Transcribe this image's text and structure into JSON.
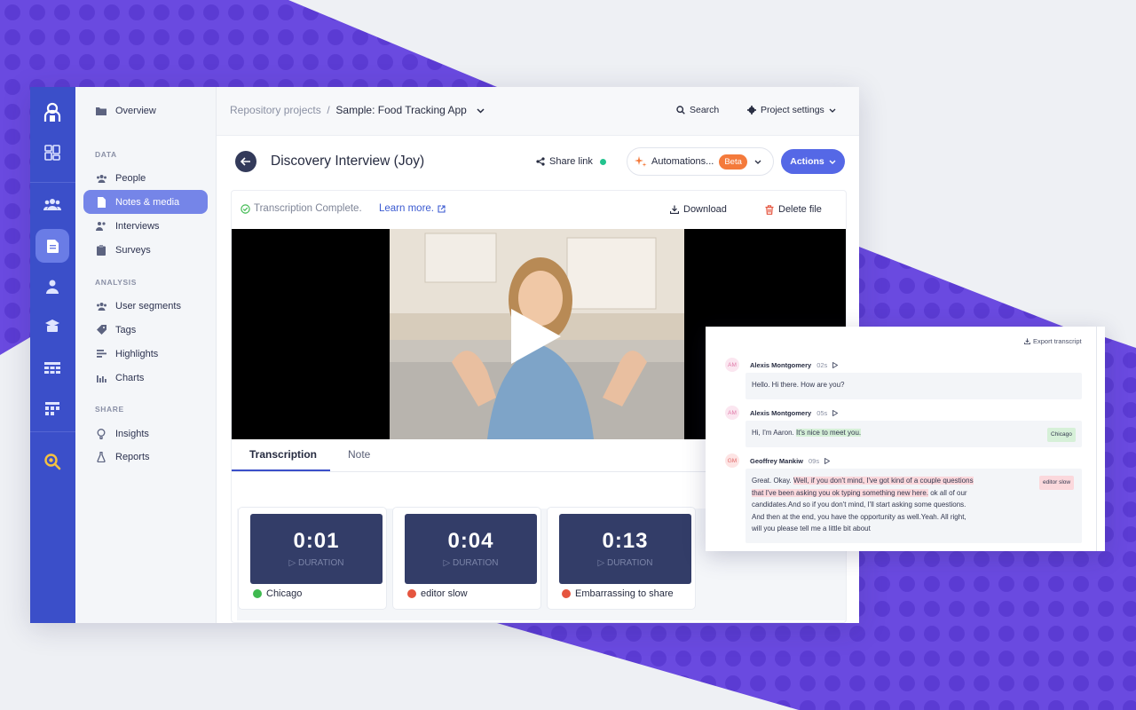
{
  "breadcrumb": {
    "parent": "Repository projects",
    "separator": "/",
    "current": "Sample: Food Tracking App"
  },
  "topbar": {
    "search_label": "Search",
    "settings_label": "Project settings"
  },
  "sidebar": {
    "overview": "Overview",
    "sections": [
      {
        "title": "DATA",
        "items": [
          "People",
          "Notes & media",
          "Interviews",
          "Surveys"
        ]
      },
      {
        "title": "ANALYSIS",
        "items": [
          "User segments",
          "Tags",
          "Highlights",
          "Charts"
        ]
      },
      {
        "title": "SHARE",
        "items": [
          "Insights",
          "Reports"
        ]
      }
    ],
    "active_item": "Notes & media"
  },
  "page": {
    "title": "Discovery Interview (Joy)",
    "share_link": "Share link",
    "automations": "Automations...",
    "beta": "Beta",
    "actions": "Actions"
  },
  "file": {
    "status": "Transcription Complete.",
    "learn_more": "Learn more.",
    "download": "Download",
    "delete": "Delete file"
  },
  "tabs": [
    "Transcription",
    "Note"
  ],
  "highlights": [
    {
      "time": "0:01",
      "duration_label": "▷ DURATION",
      "tag": "Chicago",
      "color": "#3fb950"
    },
    {
      "time": "0:04",
      "duration_label": "▷ DURATION",
      "tag": "editor slow",
      "color": "#e5553f"
    },
    {
      "time": "0:13",
      "duration_label": "▷ DURATION",
      "tag": "Embarrassing to share",
      "color": "#e5553f"
    }
  ],
  "transcript": {
    "export": "Export transcript",
    "entries": [
      {
        "initials": "AM",
        "speaker": "Alexis Montgomery",
        "time": "02s",
        "text": "Hello. Hi there. How are you?"
      },
      {
        "initials": "AM",
        "speaker": "Alexis Montgomery",
        "time": "05s",
        "text_a": "Hi, I'm Aaron.",
        "text_hl": "It's nice to meet you.",
        "tag": "Chicago"
      },
      {
        "initials": "GM",
        "speaker": "Geoffrey Mankiw",
        "time": "09s",
        "l1a": "Great. Okay.",
        "l1b": "Well, if you don't mind, I've got kind of a couple questions",
        "l2a": "that I've been asking you ok typing something new here.",
        "l2b": "ok all of our",
        "l3": "candidates.And so if you don't mind, I'll start asking some questions.",
        "l4": "And then at the end, you have the opportunity as well.Yeah. All right,",
        "l5": "will you please tell me a little bit about",
        "tag": "editor slow"
      }
    ]
  },
  "colors": {
    "rail": "#3b4fc9",
    "accent": "#5568e6",
    "beta": "#f47a3b",
    "bg_purple": "#6a4ae0"
  }
}
